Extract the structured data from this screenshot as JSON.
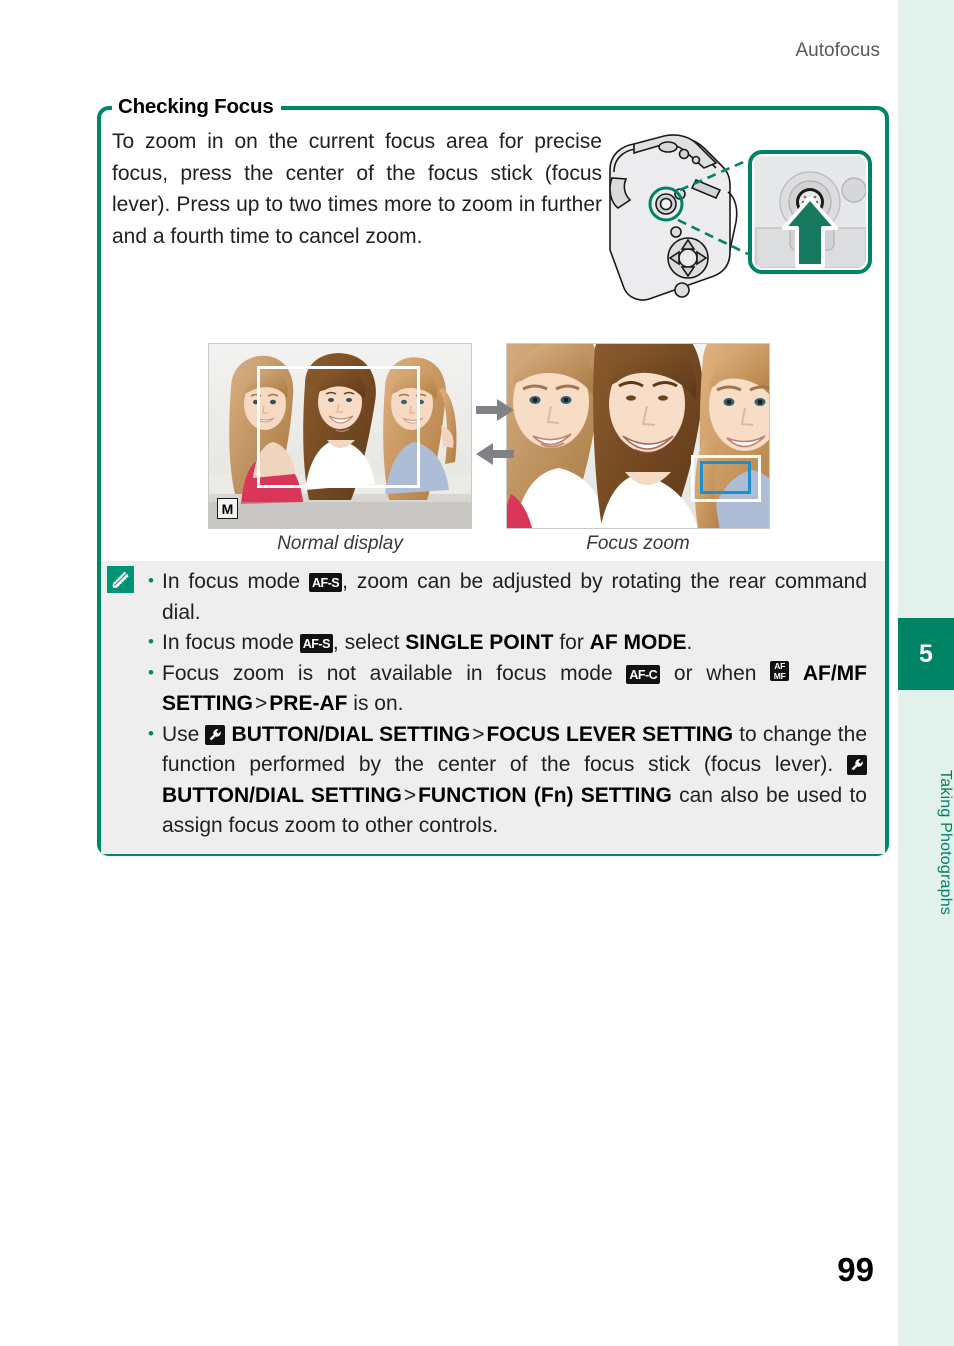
{
  "header": {
    "running_title": "Autofocus"
  },
  "chapter_tab": {
    "number": "5",
    "label": "Taking Photographs",
    "accent_color": "#008264",
    "band_color": "#e2f1ec"
  },
  "callout": {
    "title": "Checking Focus",
    "border_color": "#00876a",
    "intro": "To zoom in on the current focus area for precise focus, press the center of the focus stick (focus lever). Press up to two times more to zoom in further and a fourth time to cancel zoom."
  },
  "figure": {
    "camera_illustration_name": "camera-rear-focus-stick-illustration",
    "callout_detail_name": "focus-stick-press-detail",
    "arrow_up_color": "#1a7a5e"
  },
  "samples": {
    "normal": {
      "caption": "Normal display",
      "mode_badge": "M",
      "focus_frame_color": "#ffffff"
    },
    "zoom": {
      "caption": "Focus zoom",
      "outer_frame_color": "#ffffff",
      "inner_frame_color": "#1b8fd0"
    },
    "arrow_right_name": "arrow-right-icon",
    "arrow_left_name": "arrow-left-icon",
    "arrow_color": "#808285"
  },
  "note": {
    "icon_name": "note-pencil-icon",
    "icon_color": "#009475",
    "background": "#eeeeee",
    "bullets": [
      {
        "id": "bullet-rear-command-dial",
        "parts": [
          {
            "type": "text",
            "value": "In focus mode "
          },
          {
            "type": "badge-af",
            "value": "AF-S"
          },
          {
            "type": "text",
            "value": ", zoom can be adjusted by rotating the rear command dial."
          }
        ]
      },
      {
        "id": "bullet-single-point",
        "parts": [
          {
            "type": "text",
            "value": "In focus mode "
          },
          {
            "type": "badge-af",
            "value": "AF-S"
          },
          {
            "type": "text",
            "value": ", select "
          },
          {
            "type": "bold",
            "value": "SINGLE POINT"
          },
          {
            "type": "text",
            "value": " for "
          },
          {
            "type": "bold",
            "value": "AF MODE"
          },
          {
            "type": "text",
            "value": "."
          }
        ]
      },
      {
        "id": "bullet-not-available",
        "parts": [
          {
            "type": "text",
            "value": "Focus zoom is not available in focus mode "
          },
          {
            "type": "badge-af",
            "value": "AF-C"
          },
          {
            "type": "text",
            "value": " or when "
          },
          {
            "type": "badge-afmf",
            "value": "AF/MF"
          },
          {
            "type": "bold",
            "value": "AF/MF SETTING"
          },
          {
            "type": "gt",
            "value": ">"
          },
          {
            "type": "bold",
            "value": "PRE-AF"
          },
          {
            "type": "text",
            "value": " is on."
          }
        ]
      },
      {
        "id": "bullet-button-dial-setting",
        "parts": [
          {
            "type": "text",
            "value": "Use "
          },
          {
            "type": "badge-wrench",
            "value": "wrench"
          },
          {
            "type": "bold",
            "value": "BUTTON/DIAL SETTING"
          },
          {
            "type": "gt",
            "value": ">"
          },
          {
            "type": "bold",
            "value": "FOCUS LEVER SETTING"
          },
          {
            "type": "text",
            "value": " to change the function performed by the center of the focus stick (focus lever). "
          },
          {
            "type": "badge-wrench",
            "value": "wrench"
          },
          {
            "type": "bold",
            "value": "BUTTON/DIAL SETTING"
          },
          {
            "type": "gt",
            "value": ">"
          },
          {
            "type": "bold",
            "value": "FUNCTION (Fn) SETTING"
          },
          {
            "type": "text",
            "value": " can also be used to assign focus zoom to other controls."
          }
        ]
      }
    ]
  },
  "footer": {
    "page_number": "99"
  }
}
